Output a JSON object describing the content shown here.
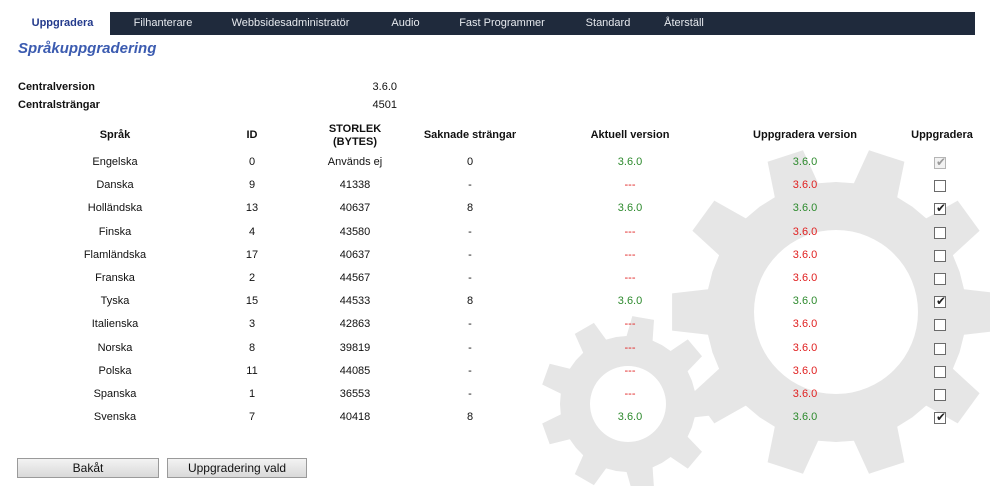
{
  "tabs": [
    {
      "label": "Uppgradera",
      "active": true
    },
    {
      "label": "Filhanterare",
      "active": false
    },
    {
      "label": "Webbsidesadministratör",
      "active": false
    },
    {
      "label": "Audio",
      "active": false
    },
    {
      "label": "Fast Programmer",
      "active": false
    },
    {
      "label": "Standard",
      "active": false
    },
    {
      "label": "Återställ",
      "active": false
    }
  ],
  "page_title": "Språkuppgradering",
  "info": {
    "central_version_label": "Centralversion",
    "central_version_value": "3.6.0",
    "central_strings_label": "Centralsträngar",
    "central_strings_value": "4501"
  },
  "columns": {
    "language": "Språk",
    "id": "ID",
    "size_line1": "STORLEK",
    "size_line2": "(BYTES)",
    "missing": "Saknade strängar",
    "current": "Aktuell version",
    "upgrade_version": "Uppgradera version",
    "upgrade": "Uppgradera"
  },
  "rows": [
    {
      "language": "Engelska",
      "id": "0",
      "size": "Används ej",
      "missing": "0",
      "current": "3.6.0",
      "current_color": "green",
      "upgrade_version": "3.6.0",
      "upgrade_color": "green",
      "checked": true,
      "disabled": true
    },
    {
      "language": "Danska",
      "id": "9",
      "size": "41338",
      "missing": "-",
      "current": "---",
      "current_color": "red",
      "upgrade_version": "3.6.0",
      "upgrade_color": "red",
      "checked": false,
      "disabled": false
    },
    {
      "language": "Holländska",
      "id": "13",
      "size": "40637",
      "missing": "8",
      "current": "3.6.0",
      "current_color": "green",
      "upgrade_version": "3.6.0",
      "upgrade_color": "green",
      "checked": true,
      "disabled": false
    },
    {
      "language": "Finska",
      "id": "4",
      "size": "43580",
      "missing": "-",
      "current": "---",
      "current_color": "red",
      "upgrade_version": "3.6.0",
      "upgrade_color": "red",
      "checked": false,
      "disabled": false
    },
    {
      "language": "Flamländska",
      "id": "17",
      "size": "40637",
      "missing": "-",
      "current": "---",
      "current_color": "red",
      "upgrade_version": "3.6.0",
      "upgrade_color": "red",
      "checked": false,
      "disabled": false
    },
    {
      "language": "Franska",
      "id": "2",
      "size": "44567",
      "missing": "-",
      "current": "---",
      "current_color": "red",
      "upgrade_version": "3.6.0",
      "upgrade_color": "red",
      "checked": false,
      "disabled": false
    },
    {
      "language": "Tyska",
      "id": "15",
      "size": "44533",
      "missing": "8",
      "current": "3.6.0",
      "current_color": "green",
      "upgrade_version": "3.6.0",
      "upgrade_color": "green",
      "checked": true,
      "disabled": false
    },
    {
      "language": "Italienska",
      "id": "3",
      "size": "42863",
      "missing": "-",
      "current": "---",
      "current_color": "red",
      "upgrade_version": "3.6.0",
      "upgrade_color": "red",
      "checked": false,
      "disabled": false
    },
    {
      "language": "Norska",
      "id": "8",
      "size": "39819",
      "missing": "-",
      "current": "---",
      "current_color": "red",
      "upgrade_version": "3.6.0",
      "upgrade_color": "red",
      "checked": false,
      "disabled": false
    },
    {
      "language": "Polska",
      "id": "11",
      "size": "44085",
      "missing": "-",
      "current": "---",
      "current_color": "red",
      "upgrade_version": "3.6.0",
      "upgrade_color": "red",
      "checked": false,
      "disabled": false
    },
    {
      "language": "Spanska",
      "id": "1",
      "size": "36553",
      "missing": "-",
      "current": "---",
      "current_color": "red",
      "upgrade_version": "3.6.0",
      "upgrade_color": "red",
      "checked": false,
      "disabled": false
    },
    {
      "language": "Svenska",
      "id": "7",
      "size": "40418",
      "missing": "8",
      "current": "3.6.0",
      "current_color": "green",
      "upgrade_version": "3.6.0",
      "upgrade_color": "green",
      "checked": true,
      "disabled": false
    }
  ],
  "buttons": {
    "back": "Bakåt",
    "upgrade_selected": "Uppgradering vald"
  },
  "icons": {
    "background": "gear-icon",
    "checkbox_checked": "checkmark-icon"
  },
  "colors": {
    "tabbar": "#1f2a3c",
    "title": "#3b5bb0",
    "ok": "#2d8a2d",
    "missing": "#e02020",
    "gear": "#e6e6e6"
  }
}
